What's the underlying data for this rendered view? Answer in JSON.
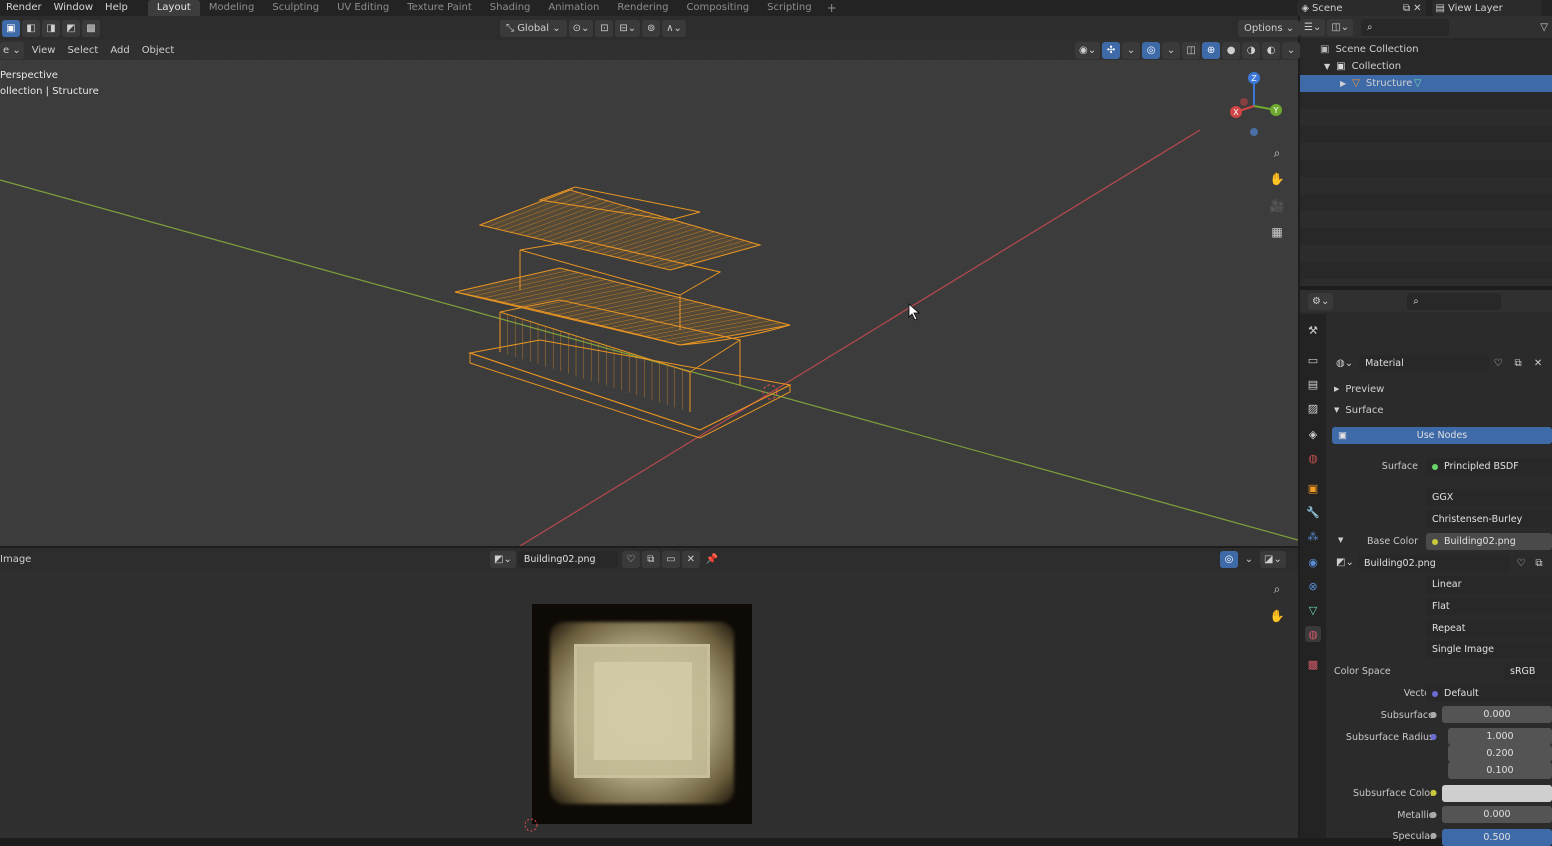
{
  "topbar": {
    "menus": [
      "Render",
      "Window",
      "Help"
    ],
    "workspaces": [
      "Layout",
      "Modeling",
      "Sculpting",
      "UV Editing",
      "Texture Paint",
      "Shading",
      "Animation",
      "Rendering",
      "Compositing",
      "Scripting"
    ],
    "active_workspace": "Layout",
    "add_tab": "+",
    "scene": "Scene",
    "view_layer": "View Layer"
  },
  "viewport_header": {
    "mode": "e",
    "menus": [
      "View",
      "Select",
      "Add",
      "Object"
    ],
    "transform_orientation": "Global",
    "options": "Options"
  },
  "viewport": {
    "view_name": "Perspective",
    "collection_path": "ollection | Structure",
    "colors": {
      "bg": "#3c3c3c",
      "selection": "#f29a22",
      "x_axis": "#b8494d",
      "y_axis": "#7ea23b"
    }
  },
  "image_editor": {
    "title": "Image",
    "image_name": "Building02.png"
  },
  "outliner": {
    "items": [
      {
        "label": "Scene Collection",
        "icon": "scene-collection-icon"
      },
      {
        "label": "Collection",
        "icon": "collection-icon"
      },
      {
        "label": "Structure",
        "icon": "mesh-object-icon",
        "selected": true
      }
    ]
  },
  "properties": {
    "material_name": "Material",
    "panels": {
      "preview": "Preview",
      "surface": "Surface"
    },
    "use_nodes": "Use Nodes",
    "surface_label": "Surface",
    "surface_value": "Principled BSDF",
    "distribution": "GGX",
    "subsurface_method": "Christensen-Burley",
    "base_color_label": "Base Color",
    "base_color_value": "Building02.png",
    "image_datablock": "Building02.png",
    "interpolation": "Linear",
    "projection": "Flat",
    "extension": "Repeat",
    "source": "Single Image",
    "color_space_label": "Color Space",
    "color_space_value": "sRGB",
    "vector_label": "Vector",
    "vector_value": "Default",
    "subsurface_label": "Subsurface",
    "subsurface_value": "0.000",
    "subsurface_radius_label": "Subsurface Radius",
    "subsurface_radius": [
      "1.000",
      "0.200",
      "0.100"
    ],
    "subsurface_color_label": "Subsurface Color",
    "metallic_label": "Metallic",
    "metallic_value": "0.000",
    "specular_label": "Specular",
    "specular_value": "0.500"
  }
}
